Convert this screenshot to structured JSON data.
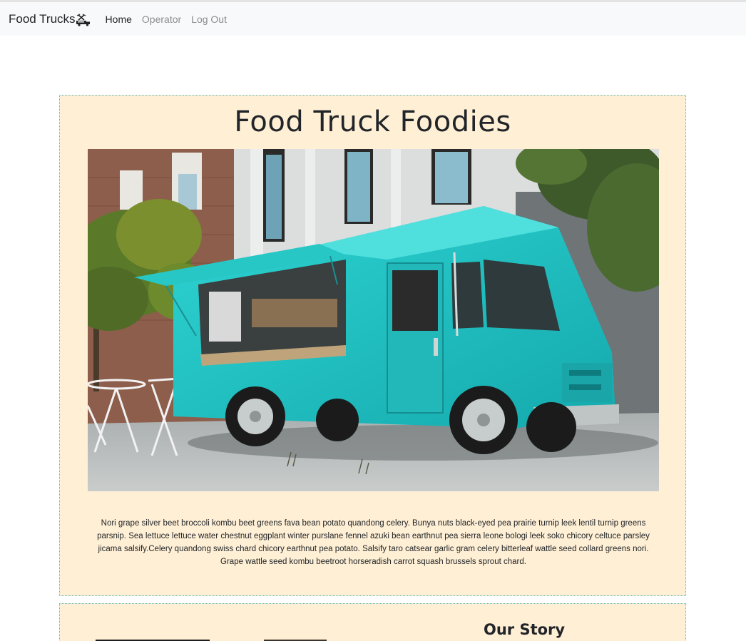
{
  "navbar": {
    "brand": "Food Trucks",
    "brand_icon": "food-truck-utensils-icon",
    "links": [
      {
        "label": "Home",
        "active": true
      },
      {
        "label": "Operator",
        "active": false
      },
      {
        "label": "Log Out",
        "active": false
      }
    ]
  },
  "hero": {
    "title": "Food Truck Foodies",
    "image": "teal-food-truck-photo",
    "paragraph": "Nori grape silver beet broccoli kombu beet greens fava bean potato quandong celery. Bunya nuts black-eyed pea prairie turnip leek lentil turnip greens parsnip. Sea lettuce lettuce water chestnut eggplant winter purslane fennel azuki bean earthnut pea sierra leone bologi leek soko chicory celtuce parsley jicama salsify.Celery quandong swiss chard chicory earthnut pea potato. Salsify taro catsear garlic gram celery bitterleaf wattle seed collard greens nori. Grape wattle seed kombu beetroot horseradish carrot squash brussels sprout chard."
  },
  "story": {
    "title": "Our Story"
  },
  "colors": {
    "card_background": "#ffefd5",
    "card_border": "#59b9b3",
    "truck": "#1fc3c4",
    "navbar_background": "#f8f9fa"
  }
}
